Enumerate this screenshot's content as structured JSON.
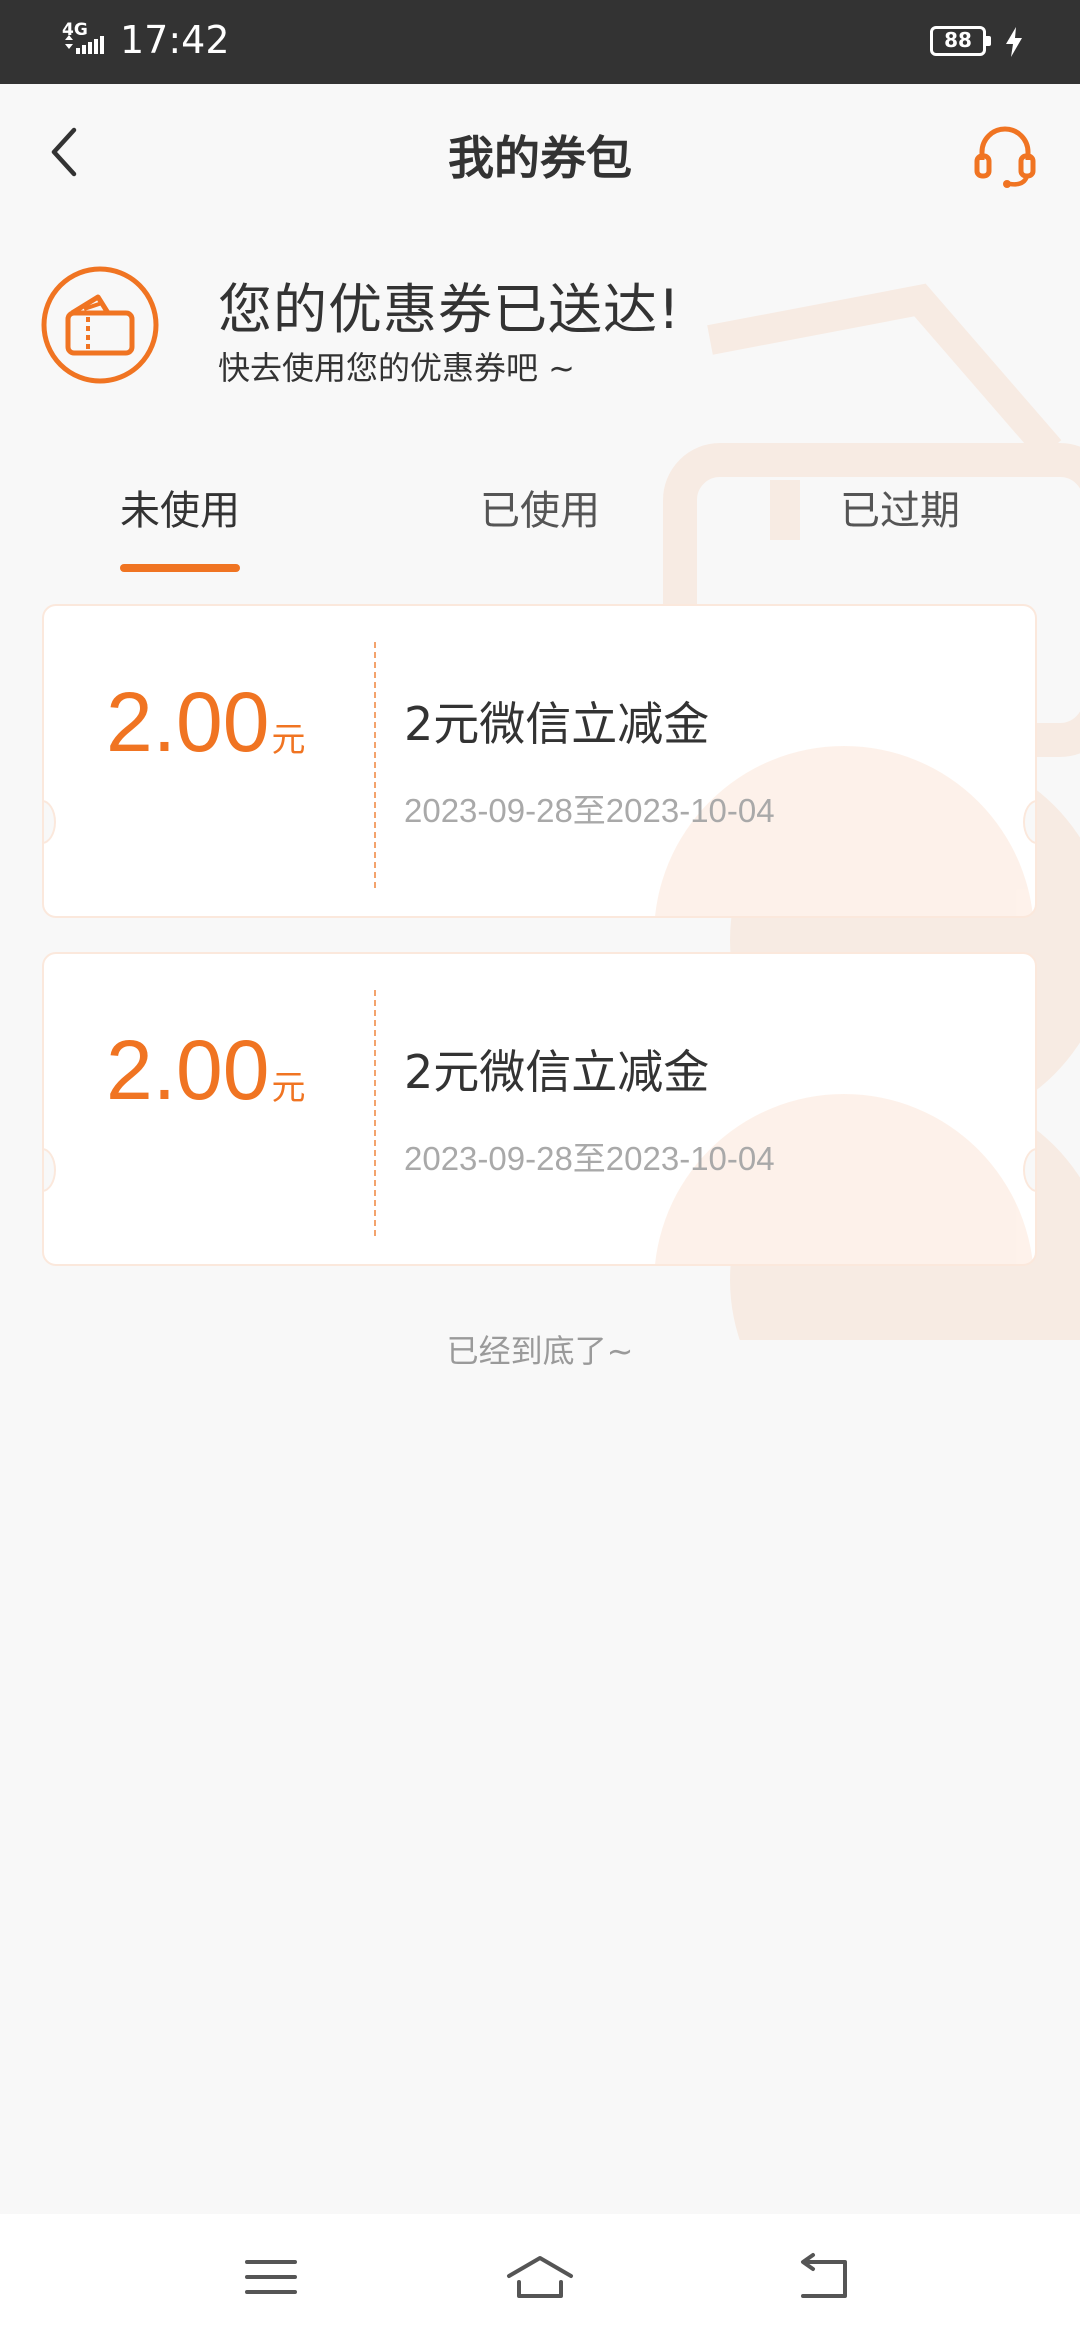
{
  "status_bar": {
    "network": "4G",
    "time": "17:42",
    "battery": "88"
  },
  "header": {
    "title": "我的券包"
  },
  "banner": {
    "title": "您的优惠券已送达!",
    "subtitle": "快去使用您的优惠券吧 ~"
  },
  "tabs": [
    {
      "label": "未使用",
      "active": true
    },
    {
      "label": "已使用",
      "active": false
    },
    {
      "label": "已过期",
      "active": false
    }
  ],
  "coupons": [
    {
      "amount": "2.00",
      "unit": "元",
      "name": "2元微信立减金",
      "validity": "2023-09-28至2023-10-04"
    },
    {
      "amount": "2.00",
      "unit": "元",
      "name": "2元微信立减金",
      "validity": "2023-09-28至2023-10-04"
    }
  ],
  "footer_text": "已经到底了~",
  "theme": {
    "accent": "#f07422",
    "status_bar_bg": "#333333",
    "page_bg": "#f8f8f8"
  },
  "icons": [
    "back-arrow-icon",
    "headset-service-icon",
    "coupon-ticket-icon",
    "menu-icon",
    "home-icon",
    "return-icon"
  ]
}
